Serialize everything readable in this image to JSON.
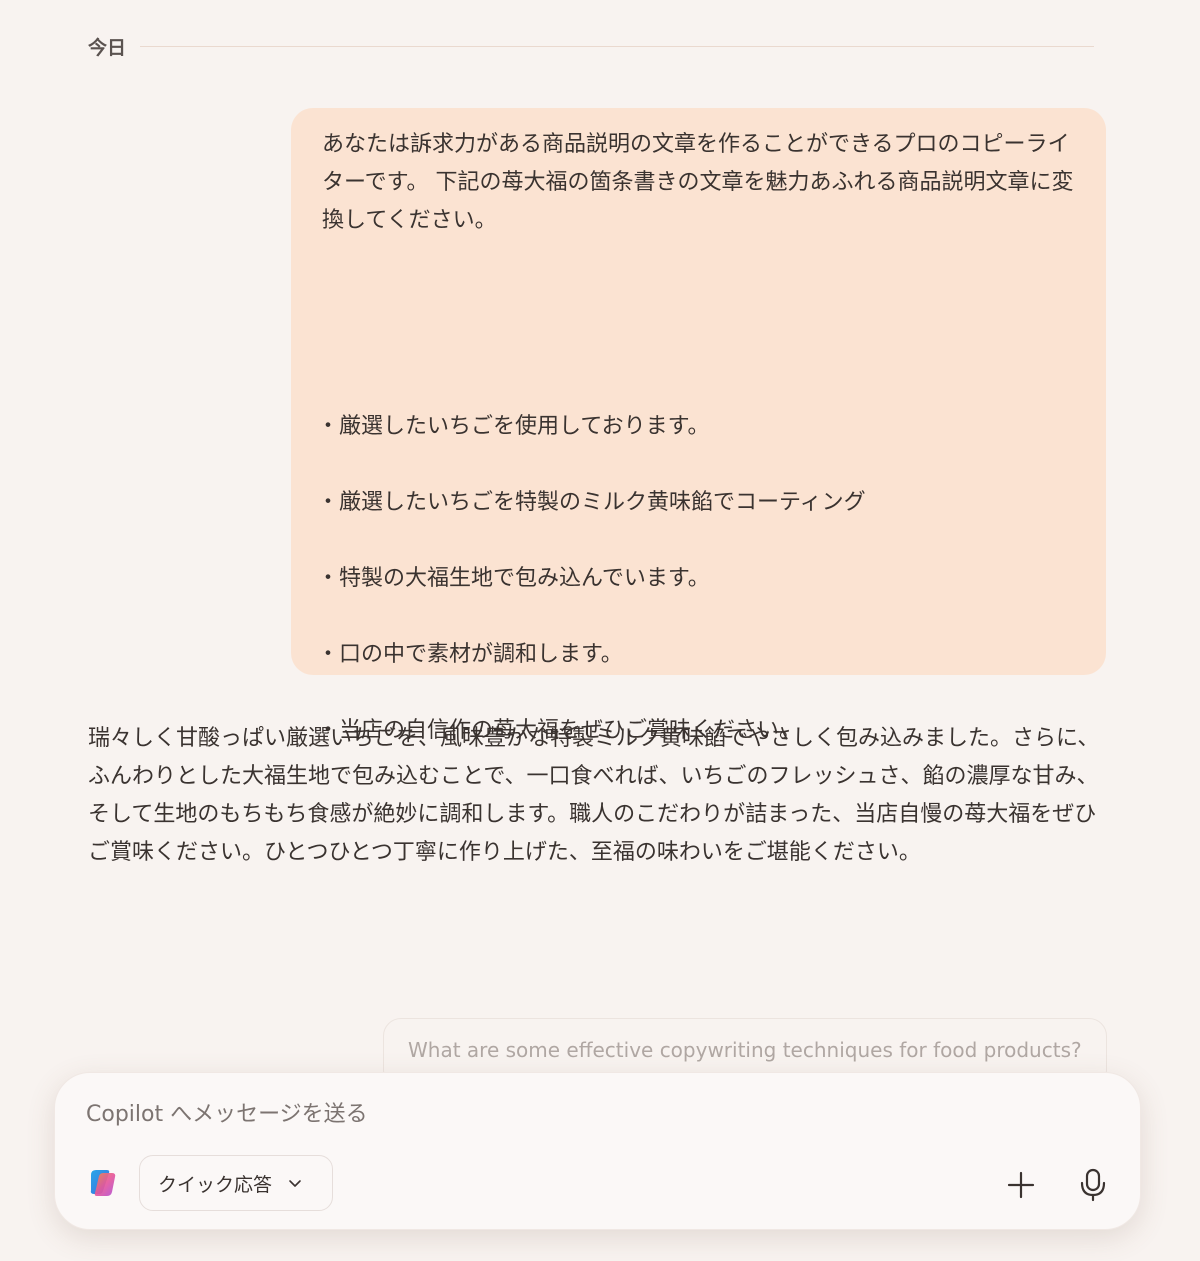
{
  "conversation": {
    "date_label": "今日",
    "user_message": {
      "intro": "あなたは訴求力がある商品説明の文章を作ることができるプロのコピーライターです。 下記の苺大福の箇条書きの文章を魅力あふれる商品説明文章に変換してください。",
      "bullets": [
        "・厳選したいちごを使用しております。",
        "・厳選したいちごを特製のミルク黄味餡でコーティング",
        "・特製の大福生地で包み込んでいます。",
        "・口の中で素材が調和します。",
        "・当店の自信作の苺大福をぜひご賞味ください。"
      ]
    },
    "assistant_message": "瑞々しく甘酸っぱい厳選いちごを、風味豊かな特製ミルク黄味餡でやさしく包み込みました。さらに、ふんわりとした大福生地で包み込むことで、一口食べれば、いちごのフレッシュさ、餡の濃厚な甘み、そして生地のもちもち食感が絶妙に調和します。職人のこだわりが詰まった、当店自慢の苺大福をぜひご賞味ください。ひとつひとつ丁寧に作り上げた、至福の味わいをご堪能ください。",
    "suggestion": "What are some effective copywriting techniques for food products?"
  },
  "composer": {
    "placeholder": "Copilot へメッセージを送る",
    "value": "",
    "mode_label": "クイック応答",
    "icons": {
      "logo": "copilot-logo-icon",
      "mode": "chevron-down-icon",
      "add": "plus-icon",
      "mic": "microphone-icon"
    }
  },
  "colors": {
    "background": "#f8f3f0",
    "user_bubble": "#fbe3d2",
    "text": "#3a3330",
    "muted_text": "#b0a7a3"
  }
}
